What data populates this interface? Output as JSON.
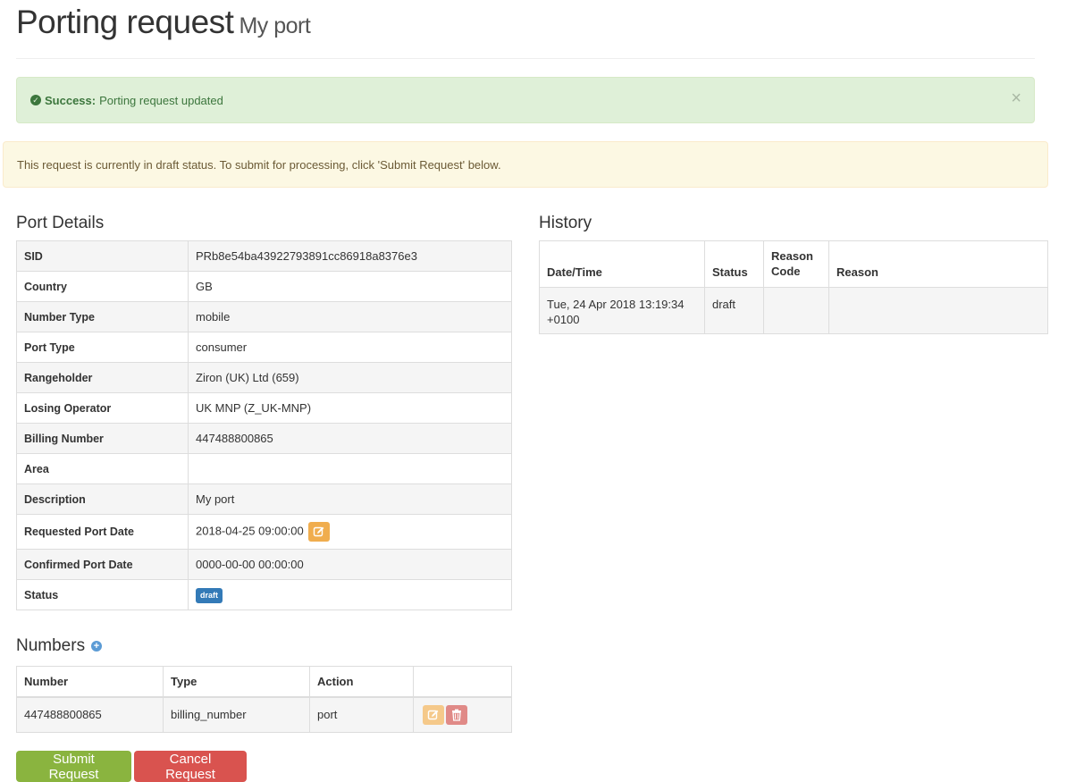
{
  "header": {
    "title": "Porting request",
    "subtitle": "My port"
  },
  "alerts": {
    "success_label": "Success:",
    "success_text": "Porting request updated",
    "close_glyph": "×",
    "warning_text": "This request is currently in draft status. To submit for processing, click 'Submit Request' below."
  },
  "port_details": {
    "heading": "Port Details",
    "rows": [
      {
        "label": "SID",
        "value": "PRb8e54ba43922793891cc86918a8376e3"
      },
      {
        "label": "Country",
        "value": "GB"
      },
      {
        "label": "Number Type",
        "value": "mobile"
      },
      {
        "label": "Port Type",
        "value": "consumer"
      },
      {
        "label": "Rangeholder",
        "value": "Ziron (UK) Ltd (659)"
      },
      {
        "label": "Losing Operator",
        "value": "UK MNP (Z_UK-MNP)"
      },
      {
        "label": "Billing Number",
        "value": "447488800865"
      },
      {
        "label": "Area",
        "value": ""
      },
      {
        "label": "Description",
        "value": "My port"
      },
      {
        "label": "Requested Port Date",
        "value": "2018-04-25 09:00:00"
      },
      {
        "label": "Confirmed Port Date",
        "value": "0000-00-00 00:00:00"
      },
      {
        "label": "Status",
        "value": "draft"
      }
    ]
  },
  "history": {
    "heading": "History",
    "columns": [
      "Date/Time",
      "Status",
      "Reason Code",
      "Reason"
    ],
    "rows": [
      {
        "datetime": "Tue, 24 Apr 2018 13:19:34 +0100",
        "status": "draft",
        "reason_code": "",
        "reason": ""
      }
    ]
  },
  "numbers": {
    "heading": "Numbers",
    "columns": [
      "Number",
      "Type",
      "Action",
      ""
    ],
    "rows": [
      {
        "number": "447488800865",
        "type": "billing_number",
        "action": "port"
      }
    ]
  },
  "buttons": {
    "submit": "Submit Request",
    "cancel": "Cancel Request"
  },
  "colors": {
    "success_bg": "#dff0d8",
    "warning_bg": "#fcf8e3",
    "edit": "#f0ad4e",
    "delete": "#d9534f",
    "status_label": "#337ab7",
    "submit": "#8ab43f",
    "cancel": "#d9534f"
  },
  "icons": {
    "success": "check-circle-icon",
    "close": "close-icon",
    "edit": "edit-icon",
    "delete": "trash-icon",
    "add": "plus-circle-icon"
  }
}
